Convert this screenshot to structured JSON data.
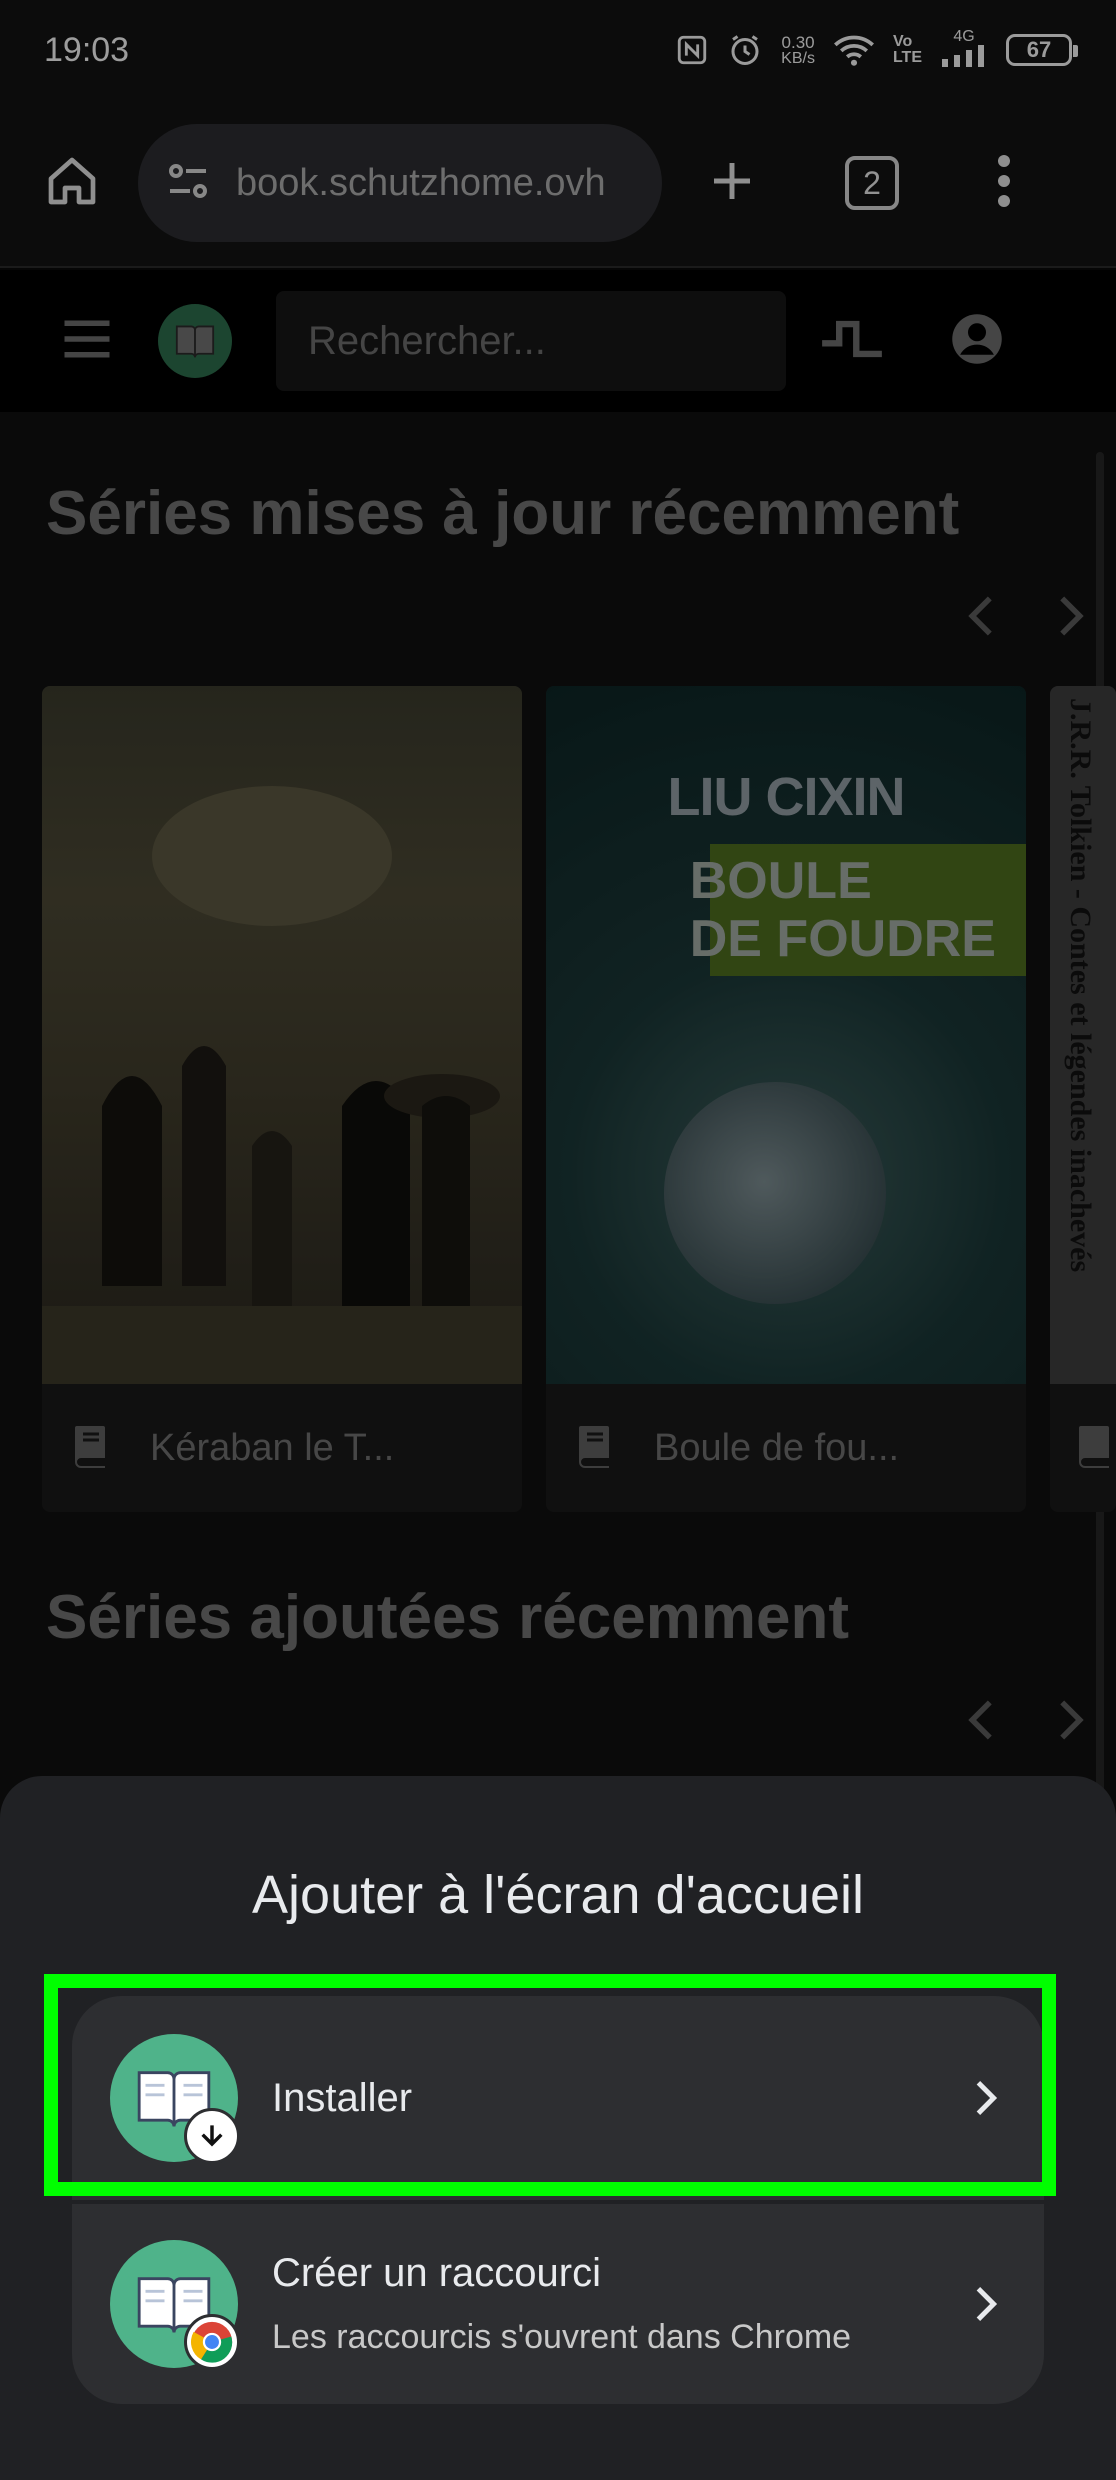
{
  "status_bar": {
    "time": "19:03",
    "net_speed_value": "0.30",
    "net_speed_unit": "KB/s",
    "volte_top": "Vo",
    "volte_bottom": "LTE",
    "network_type": "4G",
    "battery_level": "67"
  },
  "browser": {
    "url": "book.schutzhome.ovh",
    "tab_count": "2"
  },
  "site_header": {
    "search_placeholder": "Rechercher..."
  },
  "sections": [
    {
      "title": "Séries mises à jour récemment",
      "items": [
        {
          "title": "Kéraban le T..."
        },
        {
          "title": "Boule de fou..."
        },
        {
          "title": ""
        }
      ]
    },
    {
      "title": "Séries ajoutées récemment"
    }
  ],
  "covers": {
    "boule_author": "LIU CIXIN",
    "boule_title_line1": "BOULE",
    "boule_title_line2": "DE FOUDRE",
    "tolkien_spine": "J.R.R. Tolkien - Contes et légendes inachevés"
  },
  "sheet": {
    "title": "Ajouter à l'écran d'accueil",
    "options": [
      {
        "label": "Installer",
        "sublabel": ""
      },
      {
        "label": "Créer un raccourci",
        "sublabel": "Les raccourcis s'ouvrent dans Chrome"
      }
    ]
  },
  "colors": {
    "highlight": "#00ff00",
    "app_icon_bg": "#4fb38a",
    "sheet_bg": "#202124"
  },
  "icons": [
    "home-icon",
    "site-settings-icon",
    "new-tab-icon",
    "tab-switcher-icon",
    "more-options-icon",
    "menu-icon",
    "app-logo-icon",
    "activity-icon",
    "account-icon",
    "chevron-left-icon",
    "chevron-right-icon",
    "book-icon",
    "download-badge-icon",
    "chrome-badge-icon"
  ]
}
